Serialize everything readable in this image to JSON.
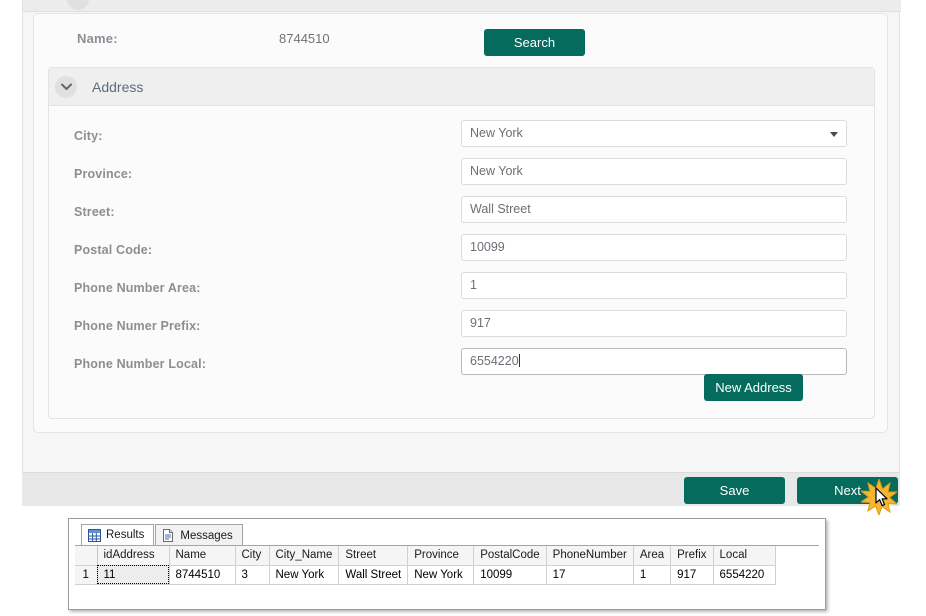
{
  "form": {
    "name_label": "Name:",
    "name_value": "8744510",
    "search_button": "Search",
    "accordion_title": "Address",
    "new_address_button": "New Address",
    "fields": [
      {
        "label": "City:",
        "value": "New York",
        "type": "select"
      },
      {
        "label": "Province:",
        "value": "New York",
        "type": "text"
      },
      {
        "label": "Street:",
        "value": "Wall Street",
        "type": "text"
      },
      {
        "label": "Postal Code:",
        "value": "10099",
        "type": "text"
      },
      {
        "label": "Phone Number Area:",
        "value": "1",
        "type": "text"
      },
      {
        "label": "Phone Numer Prefix:",
        "value": "917",
        "type": "text"
      },
      {
        "label": "Phone Number Local:",
        "value": "6554220",
        "type": "text"
      }
    ]
  },
  "footer": {
    "save_button": "Save",
    "next_button": "Next"
  },
  "results_window": {
    "tabs": [
      {
        "label": "Results",
        "icon": "grid-icon",
        "active": true
      },
      {
        "label": "Messages",
        "icon": "document-icon",
        "active": false
      }
    ],
    "columns": [
      "",
      "idAddress",
      "Name",
      "City",
      "City_Name",
      "Street",
      "Province",
      "PostalCode",
      "PhoneNumber",
      "Area",
      "Prefix",
      "Local"
    ],
    "rows": [
      [
        "1",
        "11",
        "8744510",
        "3",
        "New York",
        "Wall Street",
        "New York",
        "10099",
        "17",
        "1",
        "917",
        "6554220"
      ]
    ],
    "selected_cell": {
      "row": 0,
      "col": 1
    }
  },
  "colors": {
    "button_green": "#056b5d",
    "page_bg": "#f6f6f6",
    "footer_bg": "#e8e8e8",
    "label_gray": "#8a8f94",
    "burst_yellow": "#f5b731"
  }
}
